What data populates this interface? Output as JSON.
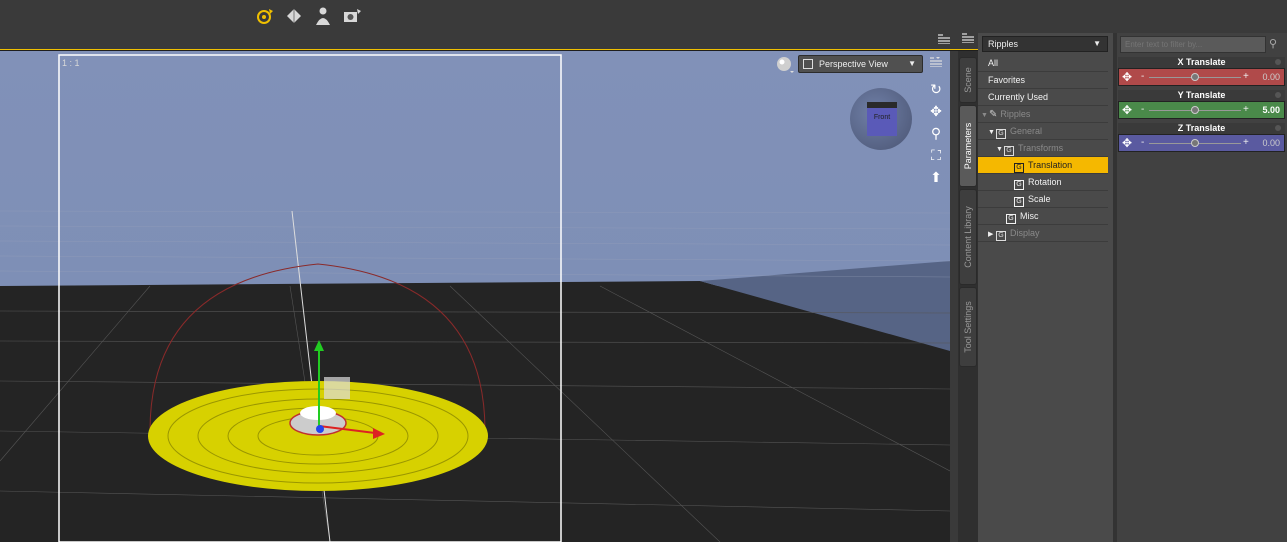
{
  "toolbar": {
    "tools": [
      {
        "icon": "universal-tool-icon",
        "color": "#f0c000"
      },
      {
        "icon": "transform-tool-icon",
        "color": "#e0e0e0"
      },
      {
        "icon": "figure-tool-icon",
        "color": "#e0e0e0"
      },
      {
        "icon": "render-camera-icon",
        "color": "#e0e0e0"
      }
    ]
  },
  "viewport": {
    "aspect_label": "1 : 1",
    "view_selector": "Perspective View",
    "cube_label": "Front",
    "nav_tools": [
      "rotate-icon",
      "pan-icon",
      "zoom-icon",
      "frame-icon",
      "reset-icon"
    ]
  },
  "side_tabs": [
    "Scene",
    "Parameters",
    "Content Library",
    "Tool Settings"
  ],
  "categories": {
    "dropdown": "Ripples",
    "items": [
      {
        "label": "All",
        "type": "plain"
      },
      {
        "label": "Favorites",
        "type": "plain"
      },
      {
        "label": "Currently Used",
        "type": "plain"
      },
      {
        "label": "Ripples",
        "type": "node"
      },
      {
        "label": "General",
        "type": "group"
      },
      {
        "label": "Transforms",
        "type": "group"
      },
      {
        "label": "Translation",
        "type": "group"
      },
      {
        "label": "Rotation",
        "type": "group"
      },
      {
        "label": "Scale",
        "type": "group"
      },
      {
        "label": "Misc",
        "type": "group"
      },
      {
        "label": "Display",
        "type": "group"
      }
    ]
  },
  "params": {
    "filter_placeholder": "Enter text to filter by...",
    "items": [
      {
        "label": "X Translate",
        "value": "0.00",
        "color": "#b04a4a",
        "position": 0.5
      },
      {
        "label": "Y Translate",
        "value": "5.00",
        "color": "#4a8a4a",
        "position": 0.5
      },
      {
        "label": "Z Translate",
        "value": "0.00",
        "color": "#5a5aa0",
        "position": 0.5
      }
    ]
  },
  "colors": {
    "accent": "#f5b800",
    "sky": "#8091b8",
    "ground": "#232323",
    "ripple": "#d7d100"
  }
}
